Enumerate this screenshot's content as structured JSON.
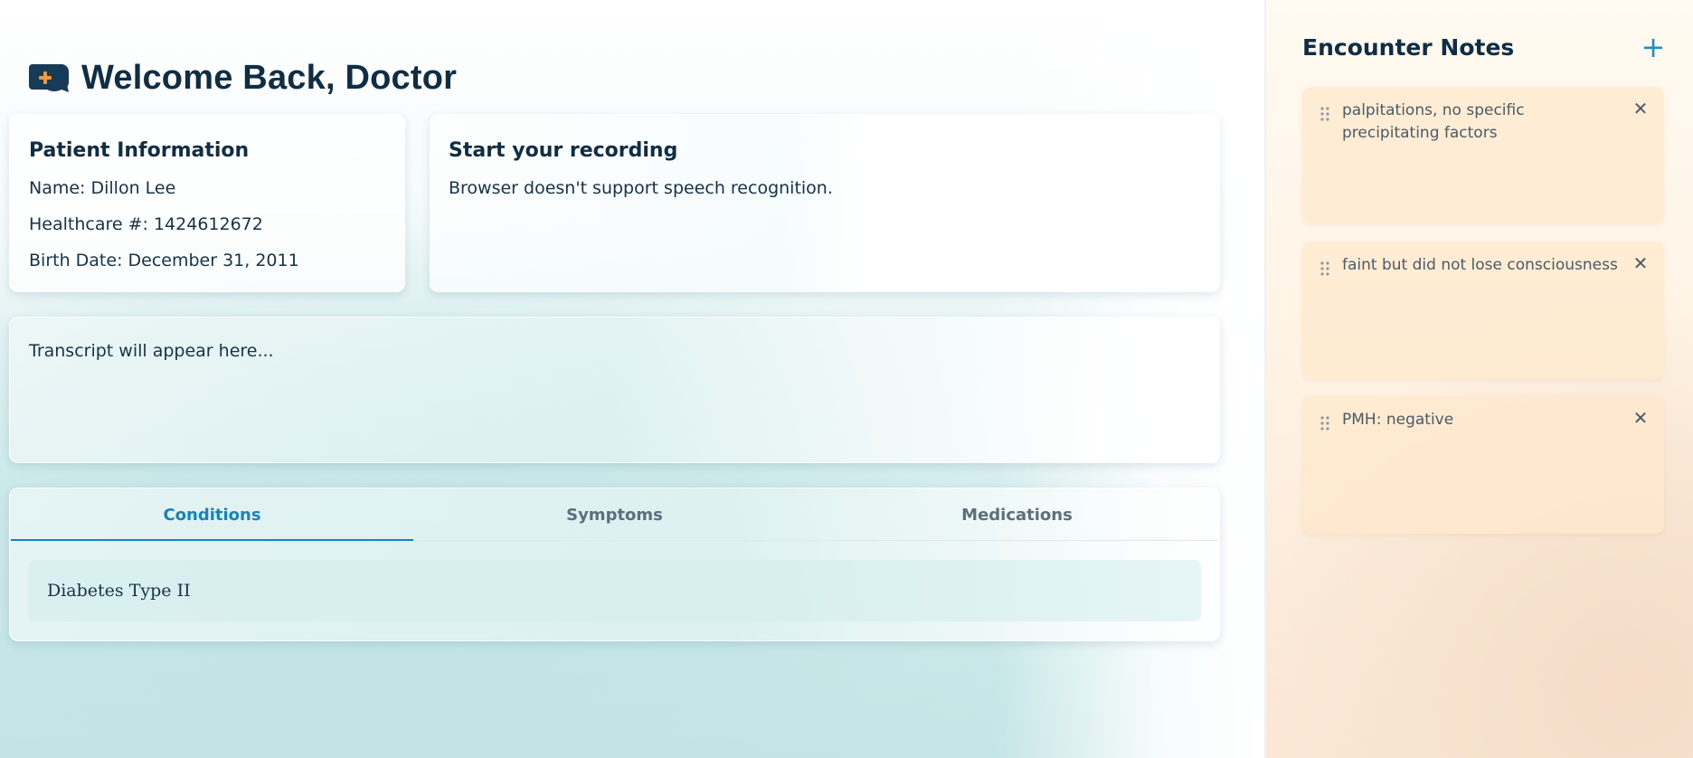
{
  "header": {
    "title": "Welcome Back, Doctor",
    "logo_icon": "chat-plus-icon"
  },
  "patient_info": {
    "title": "Patient Information",
    "name": "Name: Dillon Lee",
    "healthcare_number": "Healthcare #: 1424612672",
    "birth_date": "Birth Date: December 31, 2011"
  },
  "recording": {
    "title": "Start your recording",
    "status": "Browser doesn't support speech recognition."
  },
  "transcript": {
    "placeholder": "Transcript will appear here..."
  },
  "tabs": {
    "items": [
      {
        "label": "Conditions",
        "active": true
      },
      {
        "label": "Symptoms",
        "active": false
      },
      {
        "label": "Medications",
        "active": false
      }
    ],
    "conditions": [
      "Diabetes Type II"
    ]
  },
  "notes": {
    "title": "Encounter Notes",
    "add_icon": "plus-icon",
    "items": [
      {
        "text": "palpitations, no specific precipitating factors"
      },
      {
        "text": "faint but did not lose consciousness"
      },
      {
        "text": "PMH: negative"
      }
    ]
  },
  "colors": {
    "accent": "#1584bd",
    "title": "#0f2d44",
    "note_background": "#ffe8cc",
    "logo_orange": "#f29a3a"
  }
}
